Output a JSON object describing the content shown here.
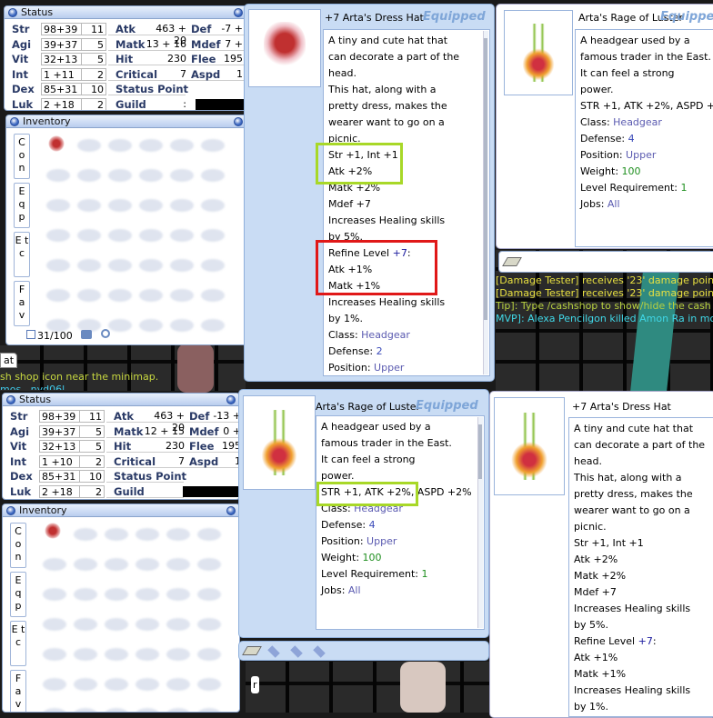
{
  "top_left": {
    "status": {
      "title": "Status",
      "stats": [
        {
          "name": "Str",
          "base": "98+39",
          "cost": "11"
        },
        {
          "name": "Agi",
          "base": "39+37",
          "cost": "5"
        },
        {
          "name": "Vit",
          "base": "32+13",
          "cost": "5"
        },
        {
          "name": "Int",
          "base": "1  +11",
          "cost": "2"
        },
        {
          "name": "Dex",
          "base": "85+31",
          "cost": "10"
        },
        {
          "name": "Luk",
          "base": "2  +18",
          "cost": "2"
        }
      ],
      "mid": [
        {
          "label": "Atk",
          "value": "463 + 20"
        },
        {
          "label": "Matk",
          "value": "13 + 16"
        },
        {
          "label": "Hit",
          "value": "230"
        },
        {
          "label": "Critical",
          "value": "7"
        },
        {
          "label": "Status Point",
          "value": ""
        },
        {
          "label": "Guild",
          "value": ":"
        }
      ],
      "right": [
        {
          "label": "Def",
          "value": "-7 +"
        },
        {
          "label": "Mdef",
          "value": "7 +"
        },
        {
          "label": "Flee",
          "value": "195"
        },
        {
          "label": "Aspd",
          "value": "1"
        }
      ]
    },
    "inventory": {
      "title": "Inventory",
      "tabs": [
        "C o n",
        "E q p",
        "E t c",
        "F a v"
      ],
      "count": "31/100"
    },
    "chat": [
      "sh shop icon near the minimap.",
      "mos ..nyd06l"
    ],
    "chat_tab": "at"
  },
  "top_middle": {
    "title": "+7 Arta's Dress Hat",
    "equipped": "Equipped",
    "lines": [
      [
        [
          "A tiny and cute hat that",
          ""
        ]
      ],
      [
        [
          "can decorate a part of the",
          ""
        ]
      ],
      [
        [
          "head.",
          ""
        ]
      ],
      [
        [
          "This hat, along with a",
          ""
        ]
      ],
      [
        [
          "pretty dress, makes the",
          ""
        ]
      ],
      [
        [
          "wearer want to go on a",
          ""
        ]
      ],
      [
        [
          "picnic.",
          ""
        ]
      ],
      [
        [
          "Str +1, Int +1",
          ""
        ]
      ],
      [
        [
          "Atk +2%",
          ""
        ]
      ],
      [
        [
          "Matk +2%",
          ""
        ]
      ],
      [
        [
          "Mdef +7",
          ""
        ]
      ],
      [
        [
          "Increases Healing skills",
          ""
        ]
      ],
      [
        [
          "by 5%.",
          ""
        ]
      ],
      [
        [
          "Refine Level ",
          ""
        ],
        [
          "+7",
          "c-navy"
        ],
        [
          ":",
          ""
        ]
      ],
      [
        [
          "Atk +1%",
          ""
        ]
      ],
      [
        [
          "Matk +1%",
          ""
        ]
      ],
      [
        [
          "Increases Healing skills",
          ""
        ]
      ],
      [
        [
          "by 1%.",
          ""
        ]
      ],
      [
        [
          "Class: ",
          ""
        ],
        [
          "Headgear",
          "c-slate"
        ]
      ],
      [
        [
          "Defense: ",
          ""
        ],
        [
          "2",
          "c-blue"
        ]
      ],
      [
        [
          "Position: ",
          ""
        ],
        [
          "Upper",
          "c-slate"
        ]
      ]
    ]
  },
  "top_right": {
    "title": "Arta's Rage of Luster",
    "equipped": "Equipped",
    "lines": [
      [
        [
          "A headgear used by a",
          ""
        ]
      ],
      [
        [
          "famous trader in the East.",
          ""
        ]
      ],
      [
        [
          "It can feel a strong",
          ""
        ]
      ],
      [
        [
          "power.",
          ""
        ]
      ],
      [
        [
          "STR +1, ATK +2%, ASPD +2%",
          ""
        ]
      ],
      [
        [
          "Class: ",
          ""
        ],
        [
          "Headgear",
          "c-slate"
        ]
      ],
      [
        [
          "Defense: ",
          ""
        ],
        [
          "4",
          "c-blue"
        ]
      ],
      [
        [
          "Position: ",
          ""
        ],
        [
          "Upper",
          "c-slate"
        ]
      ],
      [
        [
          "Weight: ",
          ""
        ],
        [
          "100",
          "c-green"
        ]
      ],
      [
        [
          "Level Requirement: ",
          ""
        ],
        [
          "1",
          "c-green"
        ]
      ],
      [
        [
          "Jobs: ",
          ""
        ],
        [
          "All",
          "c-slate"
        ]
      ]
    ],
    "chat": [
      {
        "text": "[Damage Tester] receives '23' damage points",
        "color": "#e8e040"
      },
      {
        "text": "[Damage Tester] receives '23' damage points",
        "color": "#e8e040"
      },
      {
        "text": "Tip]: Type /cashshop to show/hide the cash shop",
        "color": "#b8d040"
      },
      {
        "text": "MVP]: Alexa Pencilgon killed Amon Ra in mo",
        "color": "#40d8e8"
      }
    ]
  },
  "bottom_left": {
    "status": {
      "title": "Status",
      "stats": [
        {
          "name": "Str",
          "base": "98+39",
          "cost": "11"
        },
        {
          "name": "Agi",
          "base": "39+37",
          "cost": "5"
        },
        {
          "name": "Vit",
          "base": "32+13",
          "cost": "5"
        },
        {
          "name": "Int",
          "base": "1  +10",
          "cost": "2"
        },
        {
          "name": "Dex",
          "base": "85+31",
          "cost": "10"
        },
        {
          "name": "Luk",
          "base": "2  +18",
          "cost": "2"
        }
      ],
      "mid": [
        {
          "label": "Atk",
          "value": "463 + 20"
        },
        {
          "label": "Matk",
          "value": "12 + 15"
        },
        {
          "label": "Hit",
          "value": "230"
        },
        {
          "label": "Critical",
          "value": "7"
        },
        {
          "label": "Status Point",
          "value": ""
        },
        {
          "label": "Guild",
          "value": ""
        }
      ],
      "right": [
        {
          "label": "Def",
          "value": "-13 +"
        },
        {
          "label": "Mdef",
          "value": "0 +"
        },
        {
          "label": "Flee",
          "value": "195"
        },
        {
          "label": "Aspd",
          "value": "1"
        }
      ]
    },
    "inventory": {
      "title": "Inventory",
      "tabs": [
        "C o n",
        "E q p",
        "E t c",
        "F a v"
      ]
    }
  },
  "bottom_middle": {
    "title": "Arta's Rage of Luster",
    "equipped": "Equipped",
    "lines": [
      [
        [
          "A headgear used by a",
          ""
        ]
      ],
      [
        [
          "famous trader in the East.",
          ""
        ]
      ],
      [
        [
          "It can feel a strong",
          ""
        ]
      ],
      [
        [
          "power.",
          ""
        ]
      ],
      [
        [
          "STR +1, ATK +2%, ASPD +2%",
          ""
        ]
      ],
      [
        [
          "Class: ",
          ""
        ],
        [
          "Headgear",
          "c-slate"
        ]
      ],
      [
        [
          "Defense: ",
          ""
        ],
        [
          "4",
          "c-blue"
        ]
      ],
      [
        [
          "Position: ",
          ""
        ],
        [
          "Upper",
          "c-slate"
        ]
      ],
      [
        [
          "Weight: ",
          ""
        ],
        [
          "100",
          "c-green"
        ]
      ],
      [
        [
          "Level Requirement: ",
          ""
        ],
        [
          "1",
          "c-green"
        ]
      ],
      [
        [
          "Jobs: ",
          ""
        ],
        [
          "All",
          "c-slate"
        ]
      ]
    ],
    "chat_tab": "r"
  },
  "bottom_right": {
    "title": "+7 Arta's Dress Hat",
    "lines": [
      [
        [
          "A tiny and cute hat that",
          ""
        ]
      ],
      [
        [
          "can decorate a part of the",
          ""
        ]
      ],
      [
        [
          "head.",
          ""
        ]
      ],
      [
        [
          "This hat, along with a",
          ""
        ]
      ],
      [
        [
          "pretty dress, makes the",
          ""
        ]
      ],
      [
        [
          "wearer want to go on a",
          ""
        ]
      ],
      [
        [
          "picnic.",
          ""
        ]
      ],
      [
        [
          "Str +1, Int +1",
          ""
        ]
      ],
      [
        [
          "Atk +2%",
          ""
        ]
      ],
      [
        [
          "Matk +2%",
          ""
        ]
      ],
      [
        [
          "Mdef +7",
          ""
        ]
      ],
      [
        [
          "Increases Healing skills",
          ""
        ]
      ],
      [
        [
          "by 5%.",
          ""
        ]
      ],
      [
        [
          "Refine Level ",
          ""
        ],
        [
          "+7",
          "c-navy"
        ],
        [
          ":",
          ""
        ]
      ],
      [
        [
          "Atk +1%",
          ""
        ]
      ],
      [
        [
          "Matk +1%",
          ""
        ]
      ],
      [
        [
          "Increases Healing skills",
          ""
        ]
      ],
      [
        [
          "by 1%.",
          ""
        ]
      ]
    ]
  },
  "highlight_colors": {
    "green": "#a8d828",
    "red": "#e01818"
  }
}
